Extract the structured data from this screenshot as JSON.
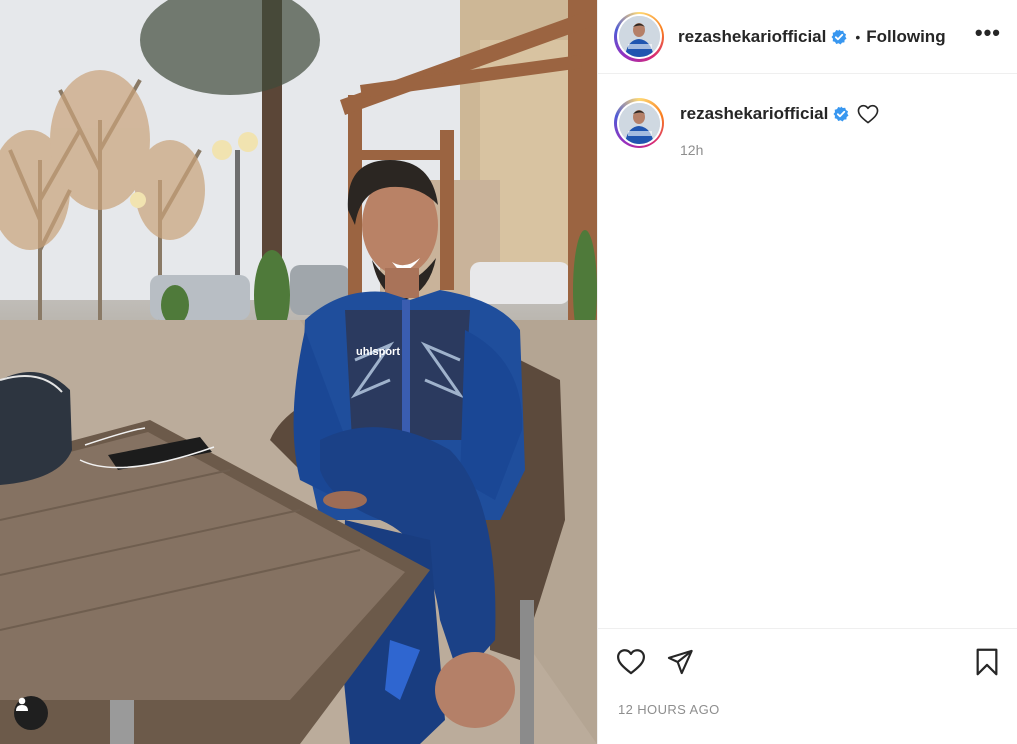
{
  "post": {
    "username": "rezashekariofficial",
    "follow_status": "Following",
    "separator": "•",
    "more_label": "•••",
    "caption_username": "rezashekariofficial",
    "relative_time": "12h",
    "timestamp": "12 HOURS AGO",
    "photo_text": "uhlsport"
  },
  "icons": {
    "verified": "verified-badge-icon",
    "more": "more-options-icon",
    "comment_like": "heart-outline-icon",
    "like": "heart-outline-icon",
    "share": "paper-plane-icon",
    "save": "bookmark-icon",
    "tags": "user-tag-icon"
  },
  "colors": {
    "verified_blue": "#3897f0",
    "text_primary": "#262626",
    "text_secondary": "#8e8e8e",
    "divider": "#efefef"
  }
}
